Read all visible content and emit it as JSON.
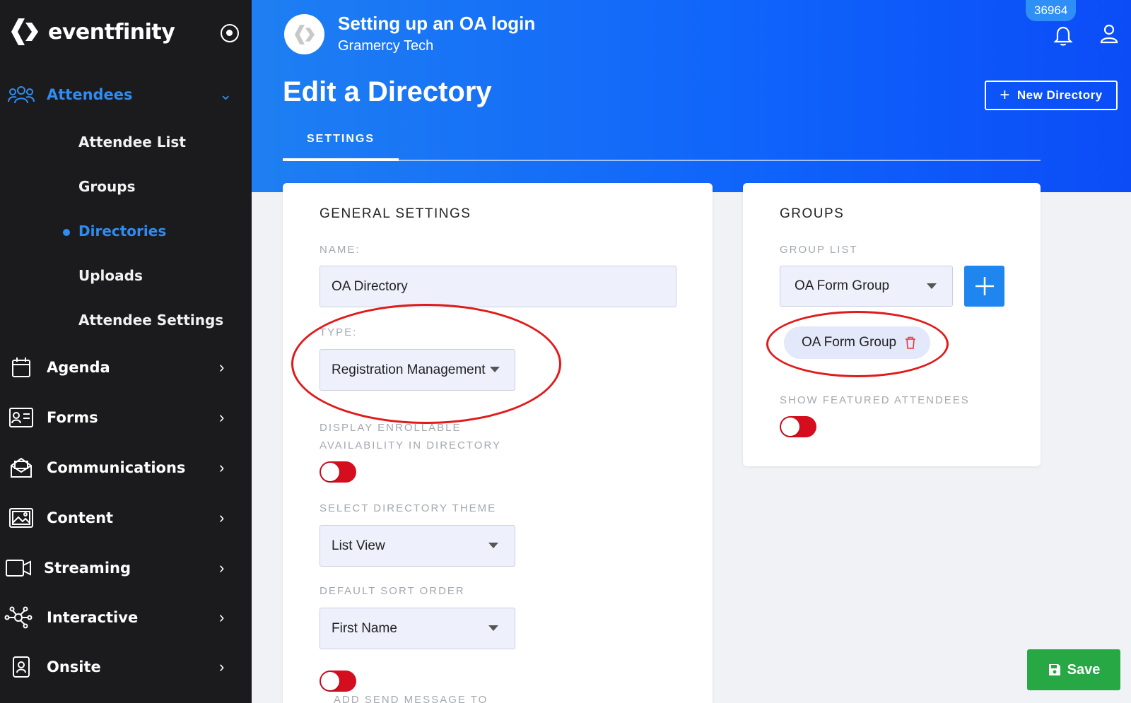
{
  "brand": {
    "name": "eventfinity"
  },
  "sidebar": {
    "sections": [
      {
        "label": "Attendees",
        "icon": "attendees-icon",
        "active": true,
        "expanded": true
      },
      {
        "label": "Agenda",
        "icon": "calendar-icon"
      },
      {
        "label": "Forms",
        "icon": "form-icon"
      },
      {
        "label": "Communications",
        "icon": "envelope-icon"
      },
      {
        "label": "Content",
        "icon": "image-icon"
      },
      {
        "label": "Streaming",
        "icon": "video-icon"
      },
      {
        "label": "Interactive",
        "icon": "network-icon"
      },
      {
        "label": "Onsite",
        "icon": "badge-icon"
      }
    ],
    "attendee_items": [
      {
        "label": "Attendee List"
      },
      {
        "label": "Groups"
      },
      {
        "label": "Directories",
        "active": true
      },
      {
        "label": "Uploads"
      },
      {
        "label": "Attendee Settings"
      }
    ]
  },
  "header": {
    "event_title": "Setting up an OA login",
    "event_subtitle": "Gramercy Tech",
    "notification_count": "36964",
    "page_title": "Edit a Directory",
    "new_directory_label": "New Directory",
    "tabs": [
      {
        "label": "SETTINGS",
        "active": true
      }
    ]
  },
  "general_settings": {
    "title": "GENERAL SETTINGS",
    "name_label": "NAME:",
    "name_value": "OA Directory",
    "type_label": "TYPE:",
    "type_value": "Registration Management",
    "enrollable_label_line1": "DISPLAY ENROLLABLE",
    "enrollable_label_line2": "AVAILABILITY IN DIRECTORY",
    "enrollable_enabled": false,
    "theme_label": "SELECT DIRECTORY THEME",
    "theme_value": "List View",
    "sort_label": "DEFAULT SORT ORDER",
    "sort_value": "First Name",
    "send_message_enabled": false,
    "send_message_label": "ADD SEND MESSAGE TO"
  },
  "groups": {
    "title": "GROUPS",
    "group_list_label": "GROUP LIST",
    "group_select_value": "OA Form Group",
    "selected_chip": "OA Form Group",
    "featured_label": "SHOW FEATURED ATTENDEES",
    "featured_enabled": false
  },
  "actions": {
    "save_label": "Save"
  },
  "colors": {
    "sidebar_bg": "#1b1b1d",
    "accent": "#2f8cf0",
    "header_blue": "#0f62fb",
    "toggle_off": "#d40e1f",
    "save_green": "#28a745",
    "annotation_red": "#e11a1a"
  }
}
